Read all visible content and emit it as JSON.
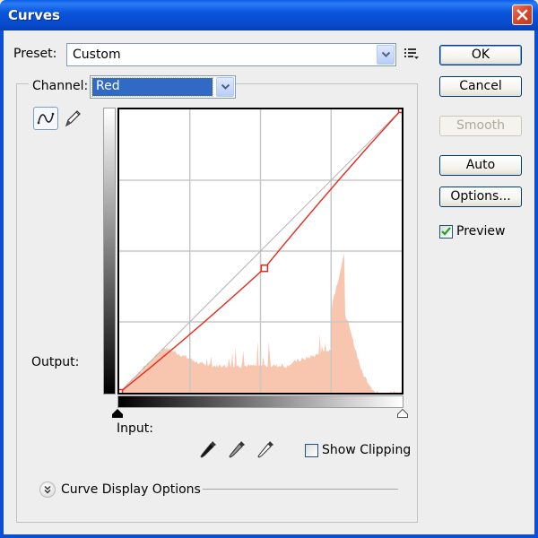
{
  "window": {
    "title": "Curves",
    "close_icon": "close-x-icon"
  },
  "preset": {
    "label": "Preset:",
    "value": "Custom",
    "menu_icon": "preset-options-menu-icon"
  },
  "channel": {
    "label": "Channel:",
    "value": "Red"
  },
  "tools": {
    "curve_tool": "curve-point-icon",
    "pencil_tool": "pencil-icon"
  },
  "graph": {
    "output_label": "Output:",
    "input_label": "Input:",
    "curve_color": "#e8281a",
    "histogram_color": "#f8c5ae",
    "grid_divisions": 4,
    "curve_points": [
      {
        "input": 0,
        "output": 0
      },
      {
        "input": 131,
        "output": 112
      },
      {
        "input": 255,
        "output": 255
      }
    ]
  },
  "eyedroppers": [
    {
      "name": "black-point-eyedropper-icon"
    },
    {
      "name": "gray-point-eyedropper-icon"
    },
    {
      "name": "white-point-eyedropper-icon"
    }
  ],
  "show_clipping": {
    "label": "Show Clipping",
    "checked": false
  },
  "curve_display_options": {
    "label": "Curve Display Options"
  },
  "buttons": {
    "ok": "OK",
    "cancel": "Cancel",
    "smooth": "Smooth",
    "auto": "Auto",
    "options": "Options..."
  },
  "preview": {
    "label": "Preview",
    "checked": true
  }
}
